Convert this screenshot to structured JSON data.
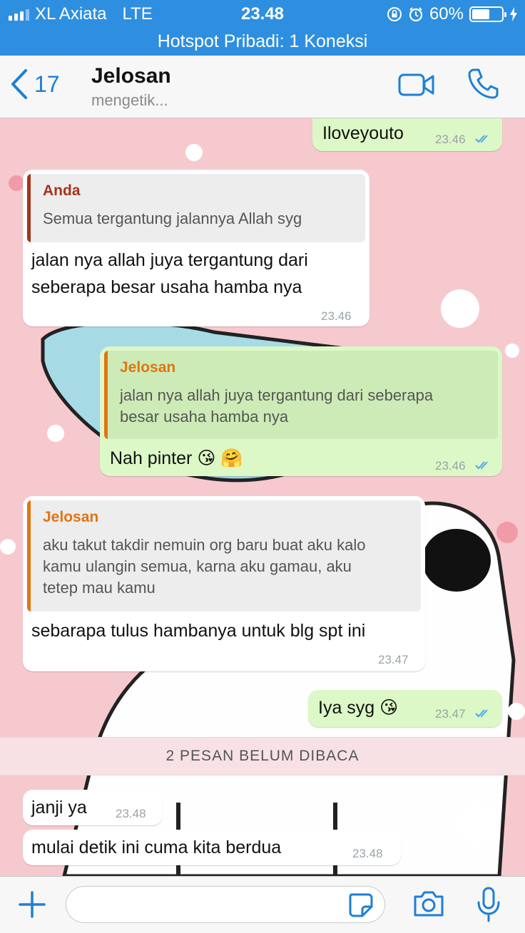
{
  "status_bar": {
    "carrier": "XL Axiata",
    "network": "LTE",
    "time": "23.48",
    "battery": "60%",
    "battery_level": 0.6
  },
  "hotspot": {
    "text": "Hotspot Pribadi: 1 Koneksi"
  },
  "header": {
    "back_count": "17",
    "contact_name": "Jelosan",
    "contact_status": "mengetik..."
  },
  "messages": [
    {
      "text": "Iloveyouto",
      "time": "23.46"
    },
    {
      "quote_name": "Anda",
      "quote_text": "Semua tergantung jalannya Allah syg",
      "line1": "jalan nya allah juya tergantung dari",
      "line2": "seberapa besar usaha hamba nya",
      "time": "23.46"
    },
    {
      "quote_name": "Jelosan",
      "quote_line1": "jalan nya allah juya tergantung dari seberapa",
      "quote_line2": "besar usaha hamba nya",
      "text": "Nah pinter",
      "emoji": "😘 🤗",
      "time": "23.46"
    },
    {
      "quote_name": "Jelosan",
      "quote_line1": "aku takut takdir nemuin org baru buat aku kalo",
      "quote_line2": "kamu ulangin semua, karna aku gamau, aku",
      "quote_line3": "tetep mau kamu",
      "text": "sebarapa tulus hambanya untuk blg spt ini",
      "time": "23.47"
    },
    {
      "text": "Iya syg",
      "emoji": "😘",
      "time": "23.47"
    },
    {
      "text": "janji ya",
      "time": "23.48"
    },
    {
      "text": "mulai detik ini cuma kita berdua",
      "time": "23.48"
    }
  ],
  "unread_banner": "2 PESAN BELUM DIBACA",
  "input": {
    "placeholder": ""
  },
  "colors": {
    "ios_blue": "#1e7fd6",
    "status_blue": "#2e8fe0",
    "outgoing_bubble": "#dcf8c6",
    "incoming_bubble": "#ffffff",
    "wallpaper_pink": "#f6c9cf",
    "quote_anda": "#a3341f",
    "quote_jelosan": "#e07512",
    "read_ticks": "#4fa8e8"
  },
  "icons": [
    "back-chevron-icon",
    "video-call-icon",
    "phone-icon",
    "plus-icon",
    "sticker-icon",
    "camera-icon",
    "microphone-icon",
    "double-check-icon"
  ]
}
